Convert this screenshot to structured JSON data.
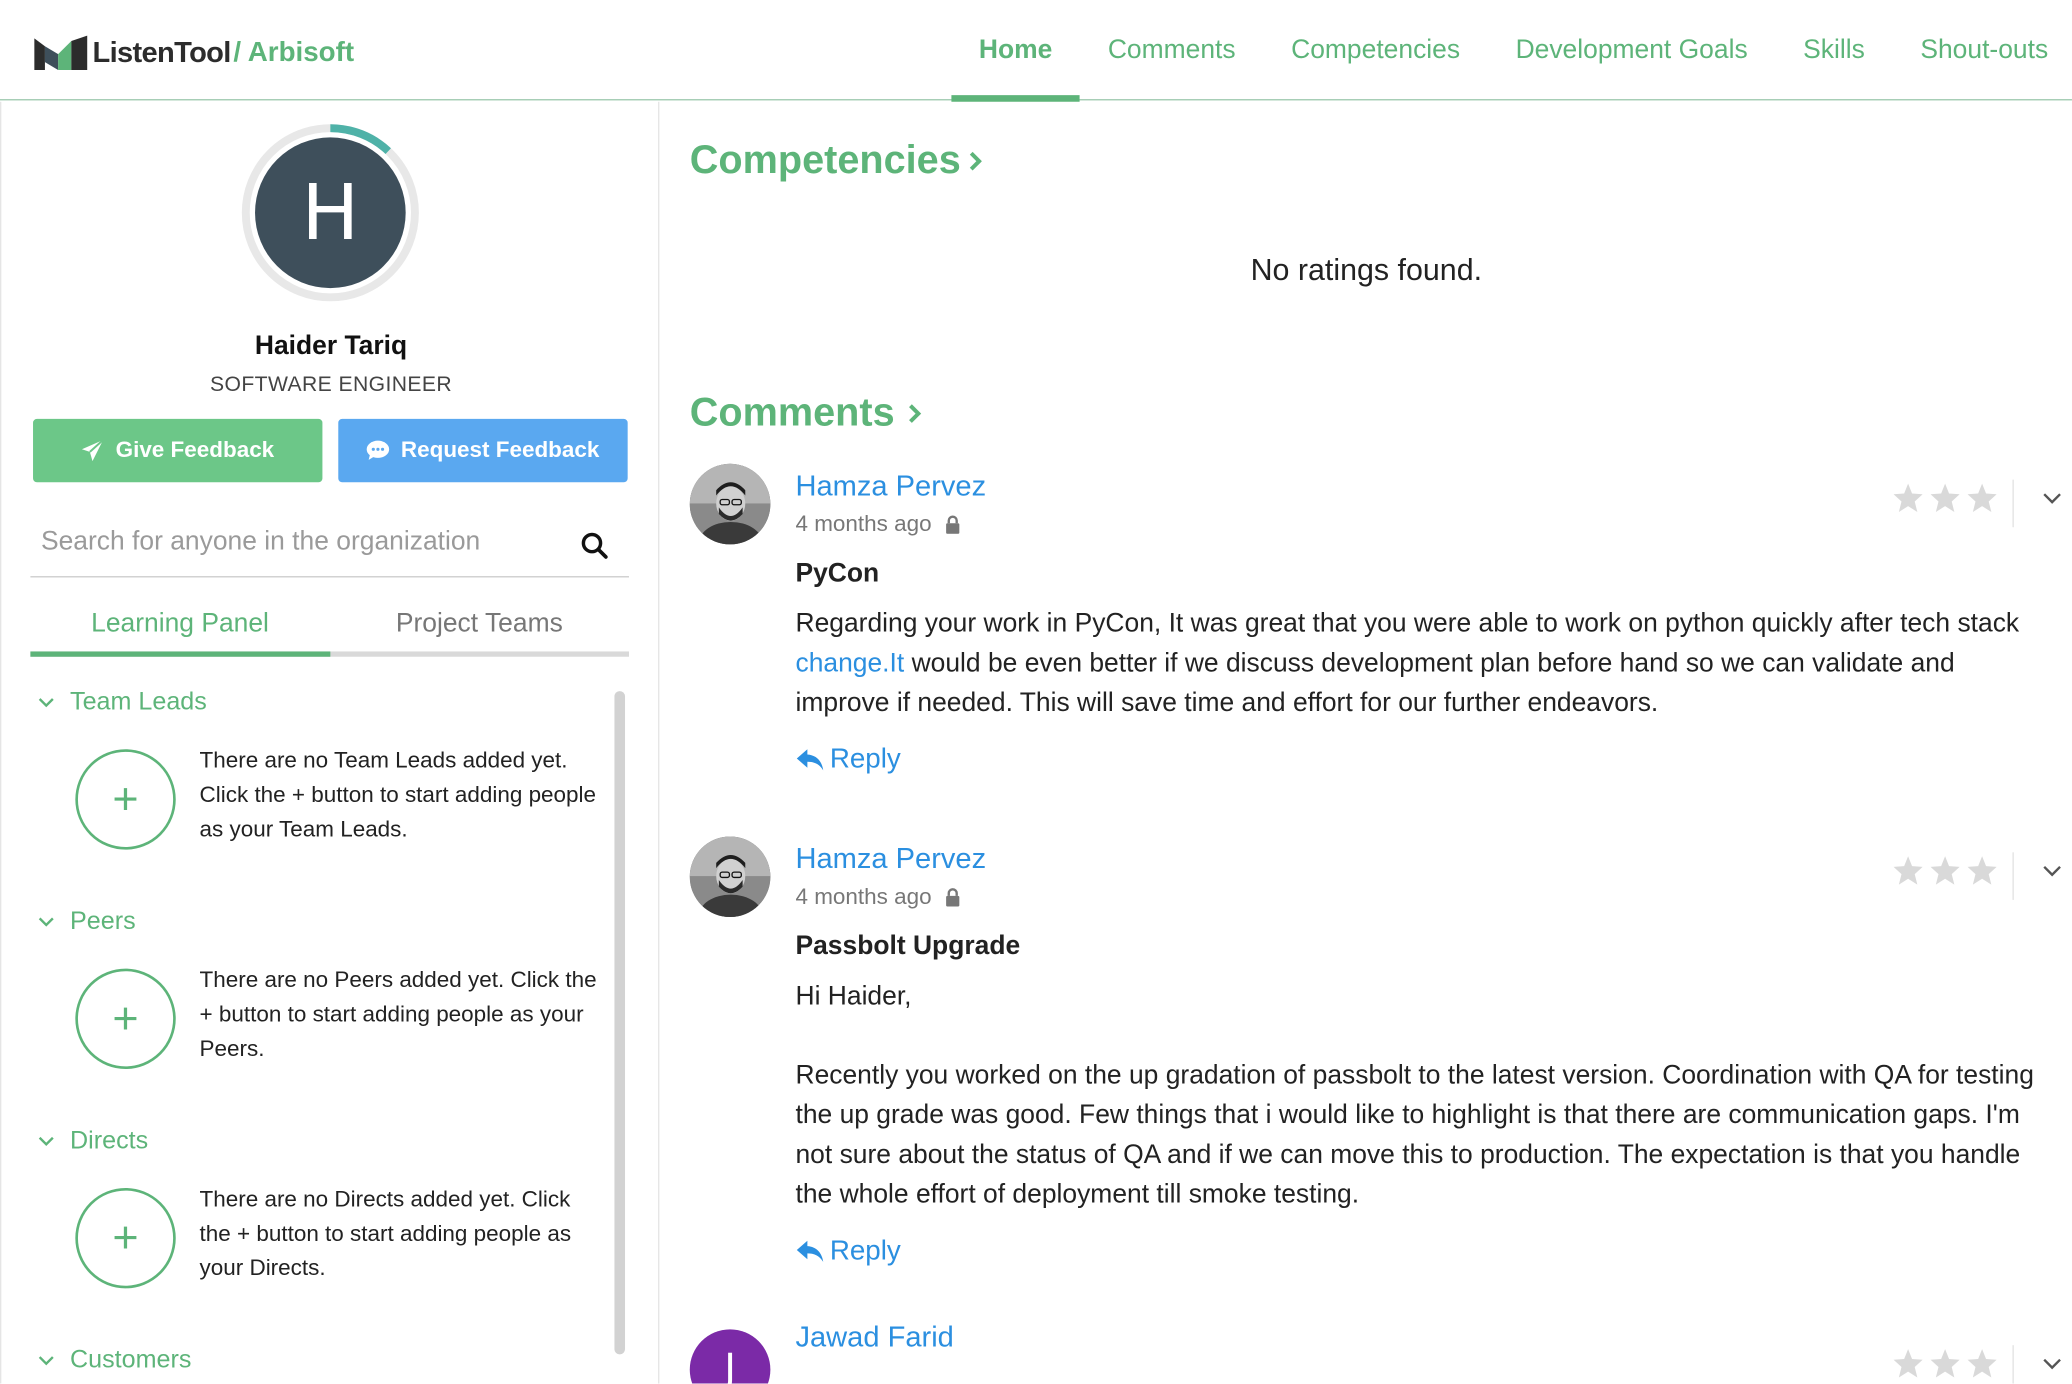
{
  "header": {
    "brand_name": "ListenTool",
    "brand_org": "/ Arbisoft",
    "nav": [
      {
        "label": "Home",
        "active": true
      },
      {
        "label": "Comments"
      },
      {
        "label": "Competencies"
      },
      {
        "label": "Development Goals"
      },
      {
        "label": "Skills"
      },
      {
        "label": "Shout-outs"
      }
    ]
  },
  "profile": {
    "initial": "H",
    "name": "Haider Tariq",
    "role": "SOFTWARE ENGINEER",
    "progress_fraction": 0.12,
    "give_feedback_label": "Give Feedback",
    "request_feedback_label": "Request Feedback",
    "search_placeholder": "Search for anyone in the organization"
  },
  "tabs": [
    {
      "label": "Learning Panel",
      "active": true
    },
    {
      "label": "Project Teams"
    }
  ],
  "groups": [
    {
      "title": "Team Leads",
      "empty_text": "There are no Team Leads added yet. Click the + button to start adding people as your Team Leads."
    },
    {
      "title": "Peers",
      "empty_text": "There are no Peers added yet. Click the + button to start adding people as your Peers."
    },
    {
      "title": "Directs",
      "empty_text": "There are no Directs added yet. Click the + button to start adding people as your Directs."
    },
    {
      "title": "Customers"
    }
  ],
  "add_symbol": "+",
  "competencies": {
    "title": "Competencies",
    "empty_text": "No ratings found."
  },
  "comments_section": {
    "title": "Comments",
    "reply_label": "Reply",
    "items": [
      {
        "author": "Hamza Pervez",
        "time": "4 months ago",
        "title": "PyCon",
        "body_before_link": "Regarding your work in PyCon, It was great that you were able to work on python quickly after tech stack ",
        "link_text": "change.It",
        "body_after_link": " would be even better if we discuss development plan before hand so we can validate and improve if needed. This will save time and effort for our further endeavors.",
        "stars": 0
      },
      {
        "author": "Hamza Pervez",
        "time": "4 months ago",
        "title": "Passbolt Upgrade",
        "greeting": "Hi Haider,",
        "body": "Recently you worked on the up gradation of passbolt to the latest version. Coordination with QA for testing the up grade was good. Few things that i would like to highlight is that there are communication gaps. I'm not sure about the status of QA and if we can move this to production. The expectation is that you handle the whole effort of deployment till smoke testing.",
        "stars": 0
      },
      {
        "author": "Jawad Farid",
        "initial": "J",
        "stars": 0
      }
    ]
  },
  "colors": {
    "brand_green": "#5db479",
    "button_green": "#6cc788",
    "button_blue": "#5aa8f0",
    "link_blue": "#2b8fe0",
    "avatar_slate": "#3e4f5b",
    "avatar_purple": "#7b2aa7"
  },
  "icons": [
    "logo-icon",
    "paper-plane-icon",
    "chat-bubble-icon",
    "search-icon",
    "chevron-down-icon",
    "chevron-right-icon",
    "lock-icon",
    "star-icon",
    "reply-icon"
  ]
}
